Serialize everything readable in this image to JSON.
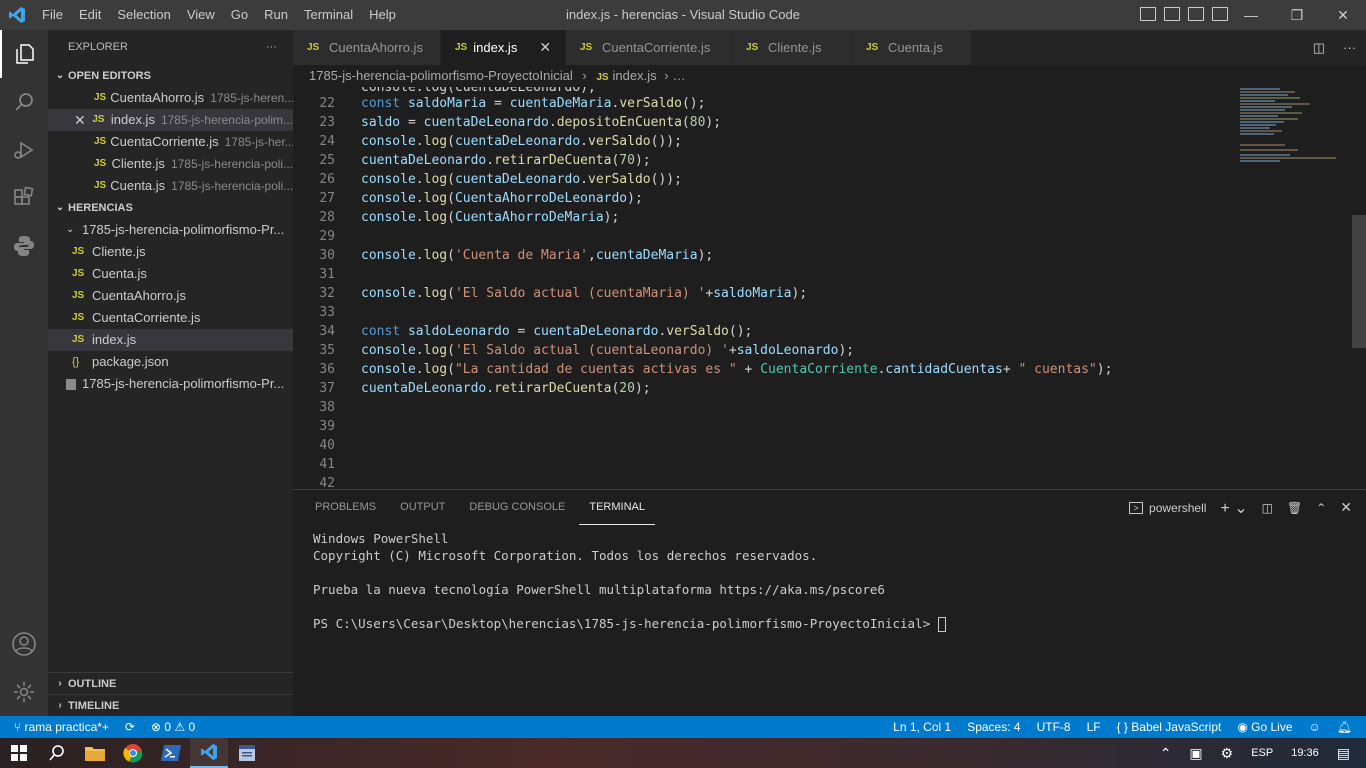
{
  "window": {
    "title": "index.js - herencias - Visual Studio Code"
  },
  "menu": [
    "File",
    "Edit",
    "Selection",
    "View",
    "Go",
    "Run",
    "Terminal",
    "Help"
  ],
  "sidebar": {
    "header": "EXPLORER",
    "more": "···",
    "open_editors": {
      "title": "OPEN EDITORS",
      "items": [
        {
          "name": "CuentaAhorro.js",
          "desc": "1785-js-heren..."
        },
        {
          "name": "index.js",
          "desc": "1785-js-herencia-polim..."
        },
        {
          "name": "CuentaCorriente.js",
          "desc": "1785-js-her..."
        },
        {
          "name": "Cliente.js",
          "desc": "1785-js-herencia-poli..."
        },
        {
          "name": "Cuenta.js",
          "desc": "1785-js-herencia-poli..."
        }
      ]
    },
    "workspace": {
      "title": "HERENCIAS",
      "folder": "1785-js-herencia-polimorfismo-Pr...",
      "files": [
        "Cliente.js",
        "Cuenta.js",
        "CuentaAhorro.js",
        "CuentaCorriente.js",
        "index.js",
        "package.json"
      ],
      "extra": "1785-js-herencia-polimorfismo-Pr..."
    },
    "outline": "OUTLINE",
    "timeline": "TIMELINE"
  },
  "tabs": [
    "CuentaAhorro.js",
    "index.js",
    "CuentaCorriente.js",
    "Cliente.js",
    "Cuenta.js"
  ],
  "tab_icon": "JS",
  "breadcrumb": {
    "folder": "1785-js-herencia-polimorfismo-ProyectoInicial",
    "sep": "›",
    "file": "index.js",
    "tail": "…"
  },
  "panel": {
    "tabs": [
      "PROBLEMS",
      "OUTPUT",
      "DEBUG CONSOLE",
      "TERMINAL"
    ],
    "shell": "powershell",
    "terminal": {
      "l1": "Windows PowerShell",
      "l2": "Copyright (C) Microsoft Corporation. Todos los derechos reservados.",
      "l3": "Prueba la nueva tecnología PowerShell multiplataforma https://aka.ms/pscore6",
      "l4": "PS C:\\Users\\Cesar\\Desktop\\herencias\\1785-js-herencia-polimorfismo-ProyectoInicial> "
    }
  },
  "status": {
    "branch": "rama practica*+",
    "errors": "0",
    "warnings": "0",
    "position": "Ln 1, Col 1",
    "spaces": "Spaces: 4",
    "encoding": "UTF-8",
    "eol": "LF",
    "language": "Babel JavaScript",
    "golive": "Go Live"
  },
  "taskbar": {
    "lang": "ESP",
    "time": "19:36"
  },
  "line_numbers": [
    "22",
    "23",
    "24",
    "25",
    "26",
    "27",
    "28",
    "29",
    "30",
    "31",
    "32",
    "33",
    "34",
    "35",
    "36",
    "37",
    "38",
    "39",
    "40",
    "41",
    "42"
  ],
  "code_top": "console.log(cuentaDeLeonardo);"
}
